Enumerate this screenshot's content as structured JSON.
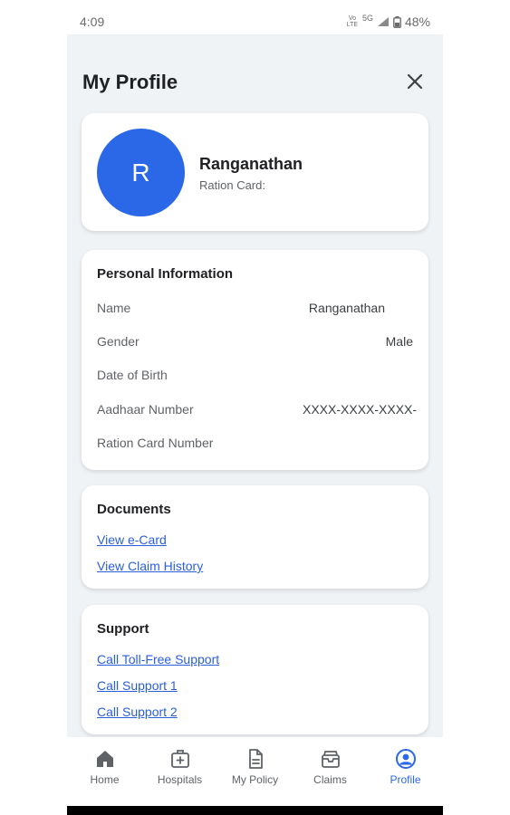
{
  "status": {
    "time": "4:09",
    "lte_label": "Vo LTE",
    "network": "5G",
    "battery": "48%"
  },
  "header": {
    "title": "My Profile"
  },
  "profile": {
    "initial": "R",
    "name": "Ranganathan",
    "ration_label": "Ration Card:"
  },
  "personal": {
    "title": "Personal Information",
    "rows": [
      {
        "label": "Name",
        "value": "Ranganathan"
      },
      {
        "label": "Gender",
        "value": "Male"
      },
      {
        "label": "Date of Birth",
        "value": ""
      },
      {
        "label": "Aadhaar Number",
        "value": "XXXX-XXXX-XXXX-"
      },
      {
        "label": "Ration Card Number",
        "value": ""
      }
    ]
  },
  "documents": {
    "title": "Documents",
    "links": [
      "View e-Card",
      "View Claim History"
    ]
  },
  "support": {
    "title": "Support",
    "links": [
      "Call Toll-Free Support",
      "Call Support 1",
      "Call Support 2"
    ]
  },
  "nav": {
    "active_color": "#2b68e8",
    "items": [
      {
        "label": "Home",
        "icon": "home-icon"
      },
      {
        "label": "Hospitals",
        "icon": "hospital-icon"
      },
      {
        "label": "My Policy",
        "icon": "policy-document-icon"
      },
      {
        "label": "Claims",
        "icon": "claims-icon"
      },
      {
        "label": "Profile",
        "icon": "profile-icon"
      }
    ]
  }
}
